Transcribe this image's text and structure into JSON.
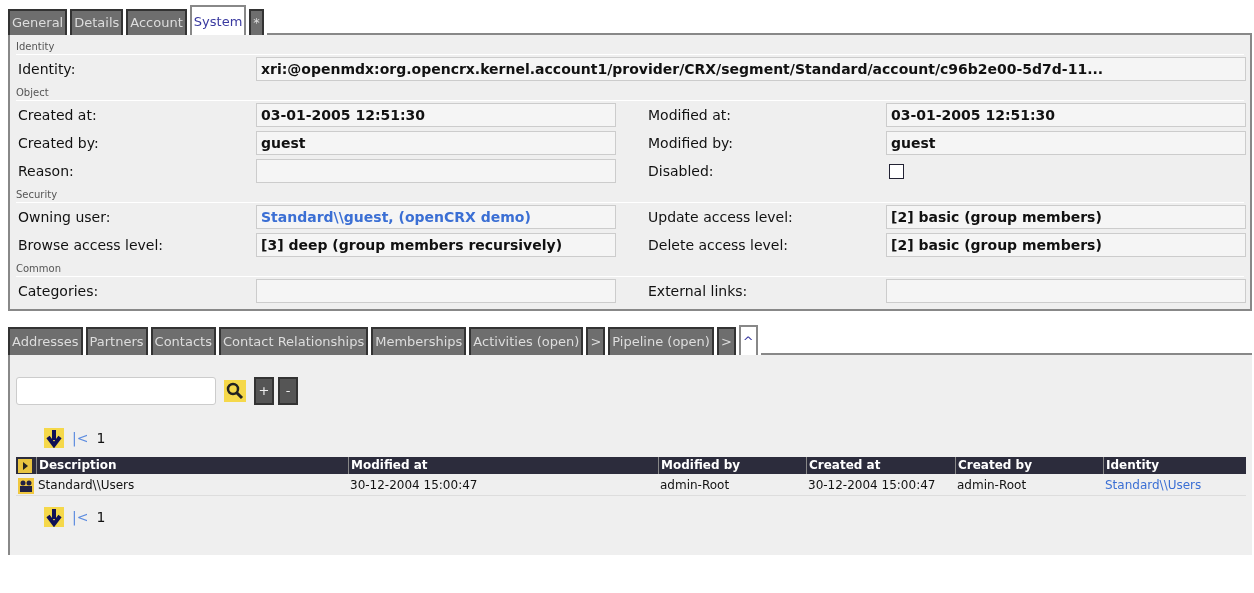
{
  "top_tabs": [
    {
      "label": "General",
      "selected": false
    },
    {
      "label": "Details",
      "selected": false
    },
    {
      "label": "Account",
      "selected": false
    },
    {
      "label": "System",
      "selected": true
    },
    {
      "label": "*",
      "selected": false
    }
  ],
  "sections": [
    {
      "title": "Identity",
      "rows": [
        {
          "fields": [
            {
              "label": "Identity:",
              "kind": "wide",
              "value": "xri:@openmdx:org.opencrx.kernel.account1/provider/CRX/segment/Standard/account/c96b2e00-5d7d-11..."
            }
          ]
        }
      ]
    },
    {
      "title": "Object",
      "rows": [
        {
          "fields": [
            {
              "label": "Created at:",
              "kind": "text",
              "value": "03-01-2005 12:51:30"
            },
            {
              "label": "Modified at:",
              "kind": "text",
              "value": "03-01-2005 12:51:30"
            }
          ]
        },
        {
          "fields": [
            {
              "label": "Created by:",
              "kind": "text",
              "value": "guest"
            },
            {
              "label": "Modified by:",
              "kind": "text",
              "value": "guest"
            }
          ]
        },
        {
          "fields": [
            {
              "label": "Reason:",
              "kind": "text"
            },
            {
              "label": "Disabled:",
              "kind": "checkbox",
              "checked": false
            }
          ]
        }
      ]
    },
    {
      "title": "Security",
      "rows": [
        {
          "fields": [
            {
              "label": "Owning user:",
              "kind": "link",
              "value": "Standard\\\\guest, (openCRX demo)"
            },
            {
              "label": "Update access level:",
              "kind": "text",
              "value": "[2] basic (group members)"
            }
          ]
        },
        {
          "fields": [
            {
              "label": "Browse access level:",
              "kind": "text",
              "value": "[3] deep (group members recursively)"
            },
            {
              "label": "Delete access level:",
              "kind": "text",
              "value": "[2] basic (group members)"
            }
          ]
        }
      ]
    },
    {
      "title": "Common",
      "rows": [
        {
          "fields": [
            {
              "label": "Categories:",
              "kind": "text"
            },
            {
              "label": "External links:",
              "kind": "text"
            }
          ]
        }
      ]
    }
  ],
  "grid_tabs": [
    {
      "label": "Addresses",
      "selected": false
    },
    {
      "label": "Partners",
      "selected": false
    },
    {
      "label": "Contacts",
      "selected": false
    },
    {
      "label": "Contact Relationships",
      "selected": false
    },
    {
      "label": "Memberships",
      "selected": false
    },
    {
      "label": "Activities (open)",
      "selected": false
    },
    {
      "label": ">",
      "selected": false
    },
    {
      "label": "Pipeline (open)",
      "selected": false
    },
    {
      "label": ">",
      "selected": false
    },
    {
      "label": "^",
      "selected": true
    }
  ],
  "toolbar": {
    "add": "+",
    "remove": "-"
  },
  "pager_top": {
    "first": "|<",
    "page": "1"
  },
  "table": {
    "columns": [
      "Description",
      "Modified at",
      "Modified by",
      "Created at",
      "Created by",
      "Identity"
    ],
    "rows": [
      {
        "cells": [
          {
            "text": "Standard\\\\Users",
            "kind": "text"
          },
          {
            "text": "30-12-2004 15:00:47",
            "kind": "text"
          },
          {
            "text": "admin-Root",
            "kind": "text"
          },
          {
            "text": "30-12-2004 15:00:47",
            "kind": "text"
          },
          {
            "text": "admin-Root",
            "kind": "text"
          },
          {
            "text": "Standard\\\\Users",
            "kind": "link"
          }
        ]
      }
    ]
  },
  "pager_bottom": {
    "first": "|<",
    "page": "1"
  }
}
